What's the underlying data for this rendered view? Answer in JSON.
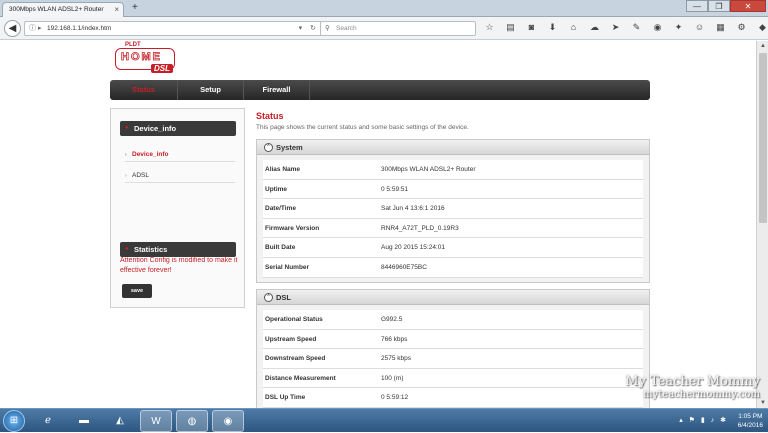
{
  "browser": {
    "tab_title": "300Mbps WLAN ADSL2+ Router",
    "tab_close": "×",
    "new_tab": "+",
    "url": "192.168.1.1/index.htm",
    "search_placeholder": "Search",
    "window_controls": [
      "—",
      "❐",
      "✕"
    ]
  },
  "logo": {
    "brand_small": "PLDT",
    "brand_main": "HOME",
    "brand_sub": "DSL"
  },
  "nav": {
    "tabs": [
      "Status",
      "Setup",
      "Firewall"
    ],
    "active": "Status"
  },
  "sidebar": {
    "sections": [
      {
        "label": "Device_info",
        "items": [
          "Device_info",
          "ADSL"
        ]
      },
      {
        "label": "Statistics",
        "items": []
      }
    ],
    "attention": "Attention Config is modified to make it effective forever!",
    "save_label": "save"
  },
  "content": {
    "title": "Status",
    "description": "This page shows the current status and some basic settings of the device.",
    "system": {
      "header": "System",
      "rows": [
        {
          "key": "Alias Name",
          "value": "300Mbps WLAN ADSL2+ Router"
        },
        {
          "key": "Uptime",
          "value": "0 5:59:51"
        },
        {
          "key": "Date/Time",
          "value": "Sat Jun 4 13:6:1 2016"
        },
        {
          "key": "Firmware Version",
          "value": "RNR4_A72T_PLD_0.19R3"
        },
        {
          "key": "Built Date",
          "value": "Aug 20 2015 15:24:01"
        },
        {
          "key": "Serial Number",
          "value": "8446960E75BC"
        }
      ]
    },
    "dsl": {
      "header": "DSL",
      "rows": [
        {
          "key": "Operational Status",
          "value": "G992.5"
        },
        {
          "key": "Upstream Speed",
          "value": "766 kbps"
        },
        {
          "key": "Downstream Speed",
          "value": "2575 kbps"
        },
        {
          "key": "Distance Measurement",
          "value": "100 (m)"
        },
        {
          "key": "DSL Up Time",
          "value": "0 5:59:12"
        }
      ]
    }
  },
  "taskbar": {
    "time": "1:05 PM",
    "date": "6/4/2016"
  },
  "watermark": {
    "line1": "My Teacher Mommy",
    "line2": "myteachermommy.com"
  },
  "colors": {
    "brand_red": "#c52027",
    "nav_dark": "#262626",
    "taskbar_blue": "#2d5680"
  }
}
